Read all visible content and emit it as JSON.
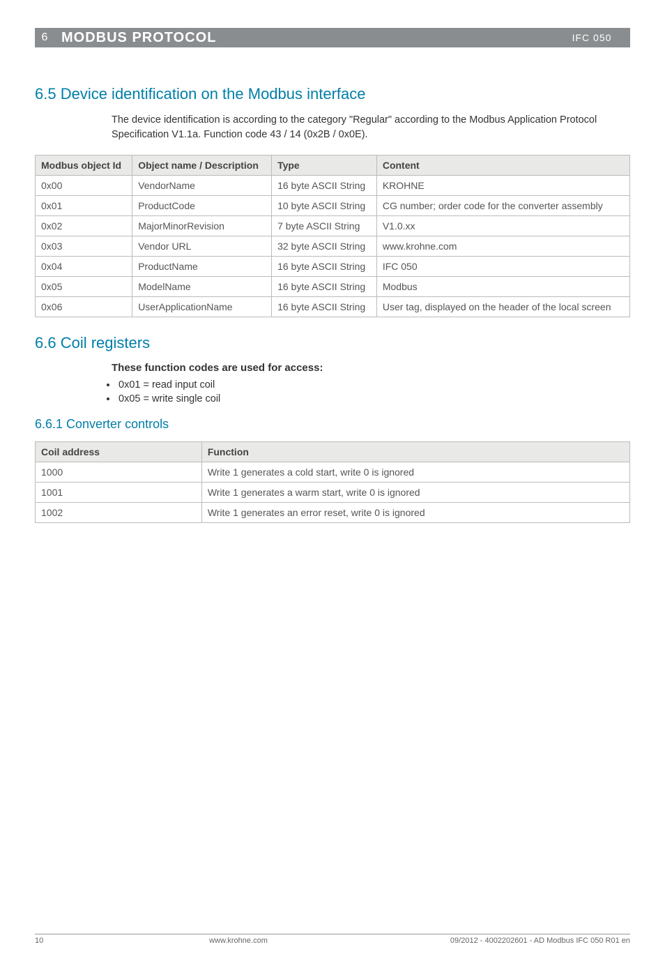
{
  "header": {
    "chapter_number": "6",
    "chapter_title": "MODBUS PROTOCOL",
    "doc_code": "IFC 050"
  },
  "section_6_5": {
    "heading": "6.5  Device identification on the Modbus interface",
    "intro": "The device identification is according to the category \"Regular\" according to the Modbus Application Protocol Specification V1.1a. Function code 43 / 14 (0x2B / 0x0E).",
    "table": {
      "headers": [
        "Modbus object Id",
        "Object name / Description",
        "Type",
        "Content"
      ],
      "rows": [
        [
          "0x00",
          "VendorName",
          "16 byte ASCII String",
          "KROHNE"
        ],
        [
          "0x01",
          "ProductCode",
          "10 byte ASCII String",
          "CG number; order code for the converter assembly"
        ],
        [
          "0x02",
          "MajorMinorRevision",
          "7 byte ASCII String",
          "V1.0.xx"
        ],
        [
          "0x03",
          "Vendor URL",
          "32 byte ASCII String",
          "www.krohne.com"
        ],
        [
          "0x04",
          "ProductName",
          "16 byte ASCII String",
          "IFC 050"
        ],
        [
          "0x05",
          "ModelName",
          "16 byte ASCII String",
          "Modbus"
        ],
        [
          "0x06",
          "UserApplicationName",
          "16 byte ASCII String",
          "User tag, displayed on the header of the local screen"
        ]
      ]
    }
  },
  "section_6_6": {
    "heading": "6.6  Coil registers",
    "subhead": "These function codes are used for access:",
    "bullets": [
      "0x01 = read input coil",
      "0x05 = write single coil"
    ],
    "subsection_heading": "6.6.1  Converter controls",
    "table": {
      "headers": [
        "Coil address",
        "Function"
      ],
      "rows": [
        [
          "1000",
          "Write 1 generates a cold start, write 0 is ignored"
        ],
        [
          "1001",
          "Write 1 generates a warm start, write 0 is ignored"
        ],
        [
          "1002",
          "Write 1 generates an error reset, write 0 is ignored"
        ]
      ]
    }
  },
  "footer": {
    "page": "10",
    "center": "www.krohne.com",
    "right": "09/2012 - 4002202601 - AD Modbus IFC 050 R01 en"
  }
}
